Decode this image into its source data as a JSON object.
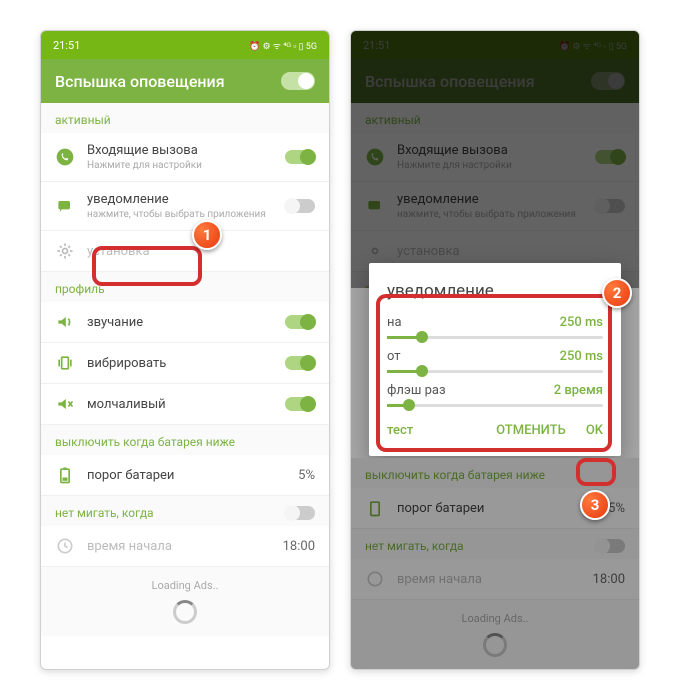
{
  "status": {
    "time": "21:51",
    "icons": "⏰ ⚙ ᯤ ⁴ᴳ ▫ ▯ 5G"
  },
  "appbar": {
    "title": "Вспышка оповещения"
  },
  "sections": {
    "active": "активный",
    "profile": "профиль",
    "battery": "выключить когда батарея ниже",
    "noflash": "нет мигать, когда"
  },
  "rows": {
    "incoming": {
      "title": "Входящие вызова",
      "sub": "Нажмите для настройки"
    },
    "notif": {
      "title": "уведомление",
      "sub": "нажмите, чтобы выбрать приложения"
    },
    "setup": {
      "title": "установка"
    },
    "sound": {
      "title": "звучание"
    },
    "vibrate": {
      "title": "вибрировать"
    },
    "silent": {
      "title": "молчаливый"
    },
    "battery": {
      "title": "порог батареи",
      "val": "5%"
    },
    "start": {
      "title": "время начала",
      "val": "18:00"
    }
  },
  "loading": "Loading Ads..",
  "dialog": {
    "title": "уведомление",
    "on": {
      "label": "на",
      "val": "250 ms",
      "pct": 16
    },
    "off": {
      "label": "от",
      "val": "250 ms",
      "pct": 16
    },
    "times": {
      "label": "флэш раз",
      "val": "2 время",
      "pct": 10
    },
    "test": "тест",
    "cancel": "ОТМЕНИТЬ",
    "ok": "OK"
  },
  "badges": {
    "b1": "1",
    "b2": "2",
    "b3": "3"
  }
}
